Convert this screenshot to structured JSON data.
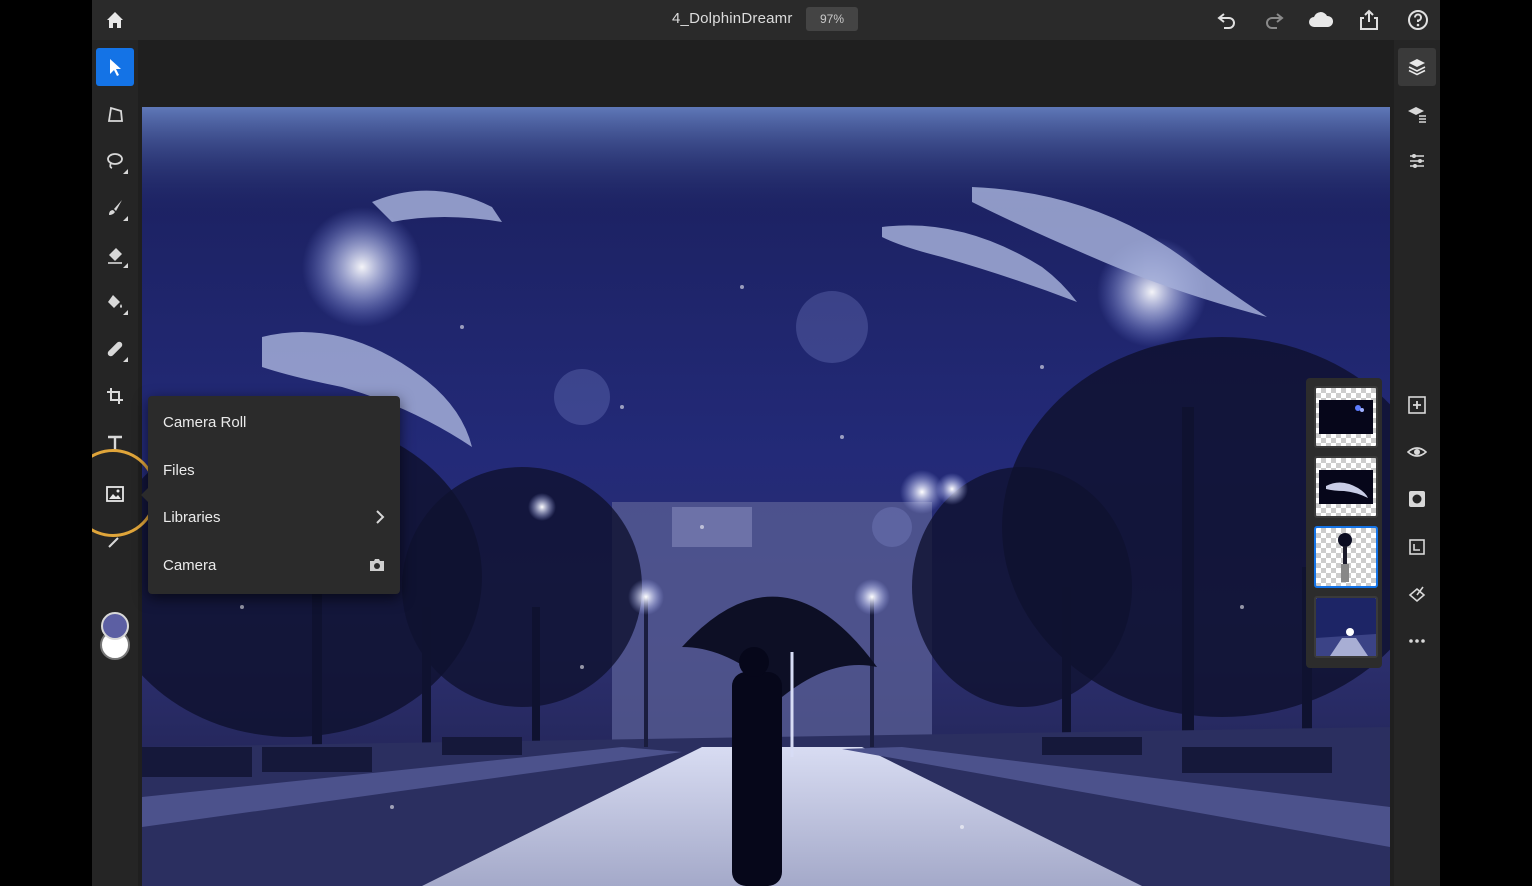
{
  "app": {
    "document_title": "4_DolphinDreamr",
    "zoom": "97%",
    "accent_color": "#1473e6",
    "highlight_color": "#e0a53a"
  },
  "topbar": {
    "icons": [
      "home-icon",
      "undo-icon",
      "redo-icon",
      "cloud-icon",
      "share-icon",
      "help-icon"
    ]
  },
  "left_toolbar": {
    "tools": [
      "select-icon",
      "transform-icon",
      "lasso-icon",
      "brush-icon",
      "eraser-icon",
      "fill-icon",
      "healing-icon",
      "crop-icon",
      "type-icon",
      "place-image-icon",
      "eyedropper-icon"
    ],
    "active_tool": "select-icon",
    "foreground_color": "#5c5fa3",
    "background_color": "#ffffff"
  },
  "place_image_menu": {
    "items": [
      {
        "label": "Camera Roll"
      },
      {
        "label": "Files"
      },
      {
        "label": "Libraries",
        "accessory": "chevron-right-icon"
      },
      {
        "label": "Camera",
        "accessory": "camera-icon"
      }
    ]
  },
  "right_toolbar": {
    "icons": [
      "layers-icon",
      "layer-properties-icon",
      "adjustments-icon",
      "add-layer-icon",
      "visibility-icon",
      "mask-icon",
      "clipping-icon",
      "merge-icon",
      "more-icon"
    ]
  },
  "layers": {
    "thumbnails": [
      "layer-bubbles",
      "layer-dolphin",
      "layer-umbrella-woman",
      "layer-night-park"
    ],
    "selected_index": 2
  }
}
